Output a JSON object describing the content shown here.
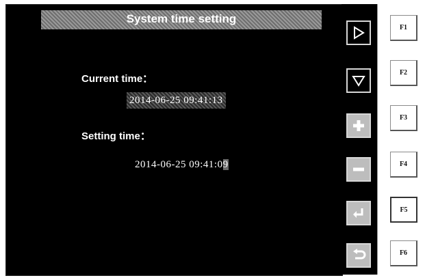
{
  "title": "System time setting",
  "current_label": "Current time：",
  "current_value": "2014-06-25 09:41:13",
  "setting_label": "Setting time：",
  "setting_value_prefix": "2014-06-25 09:41:0",
  "setting_value_selected_digit": "9",
  "side_buttons": [
    {
      "icon": "right-triangle-icon"
    },
    {
      "icon": "down-triangle-icon"
    },
    {
      "icon": "plus-icon"
    },
    {
      "icon": "minus-icon"
    },
    {
      "icon": "enter-icon"
    },
    {
      "icon": "return-icon"
    }
  ],
  "function_keys": [
    "F1",
    "F2",
    "F3",
    "F4",
    "F5",
    "F6"
  ],
  "active_function_key": "F5",
  "colors": {
    "screen": "#000000",
    "title_bar": "#8a8a8a",
    "text": "#ffffff"
  }
}
